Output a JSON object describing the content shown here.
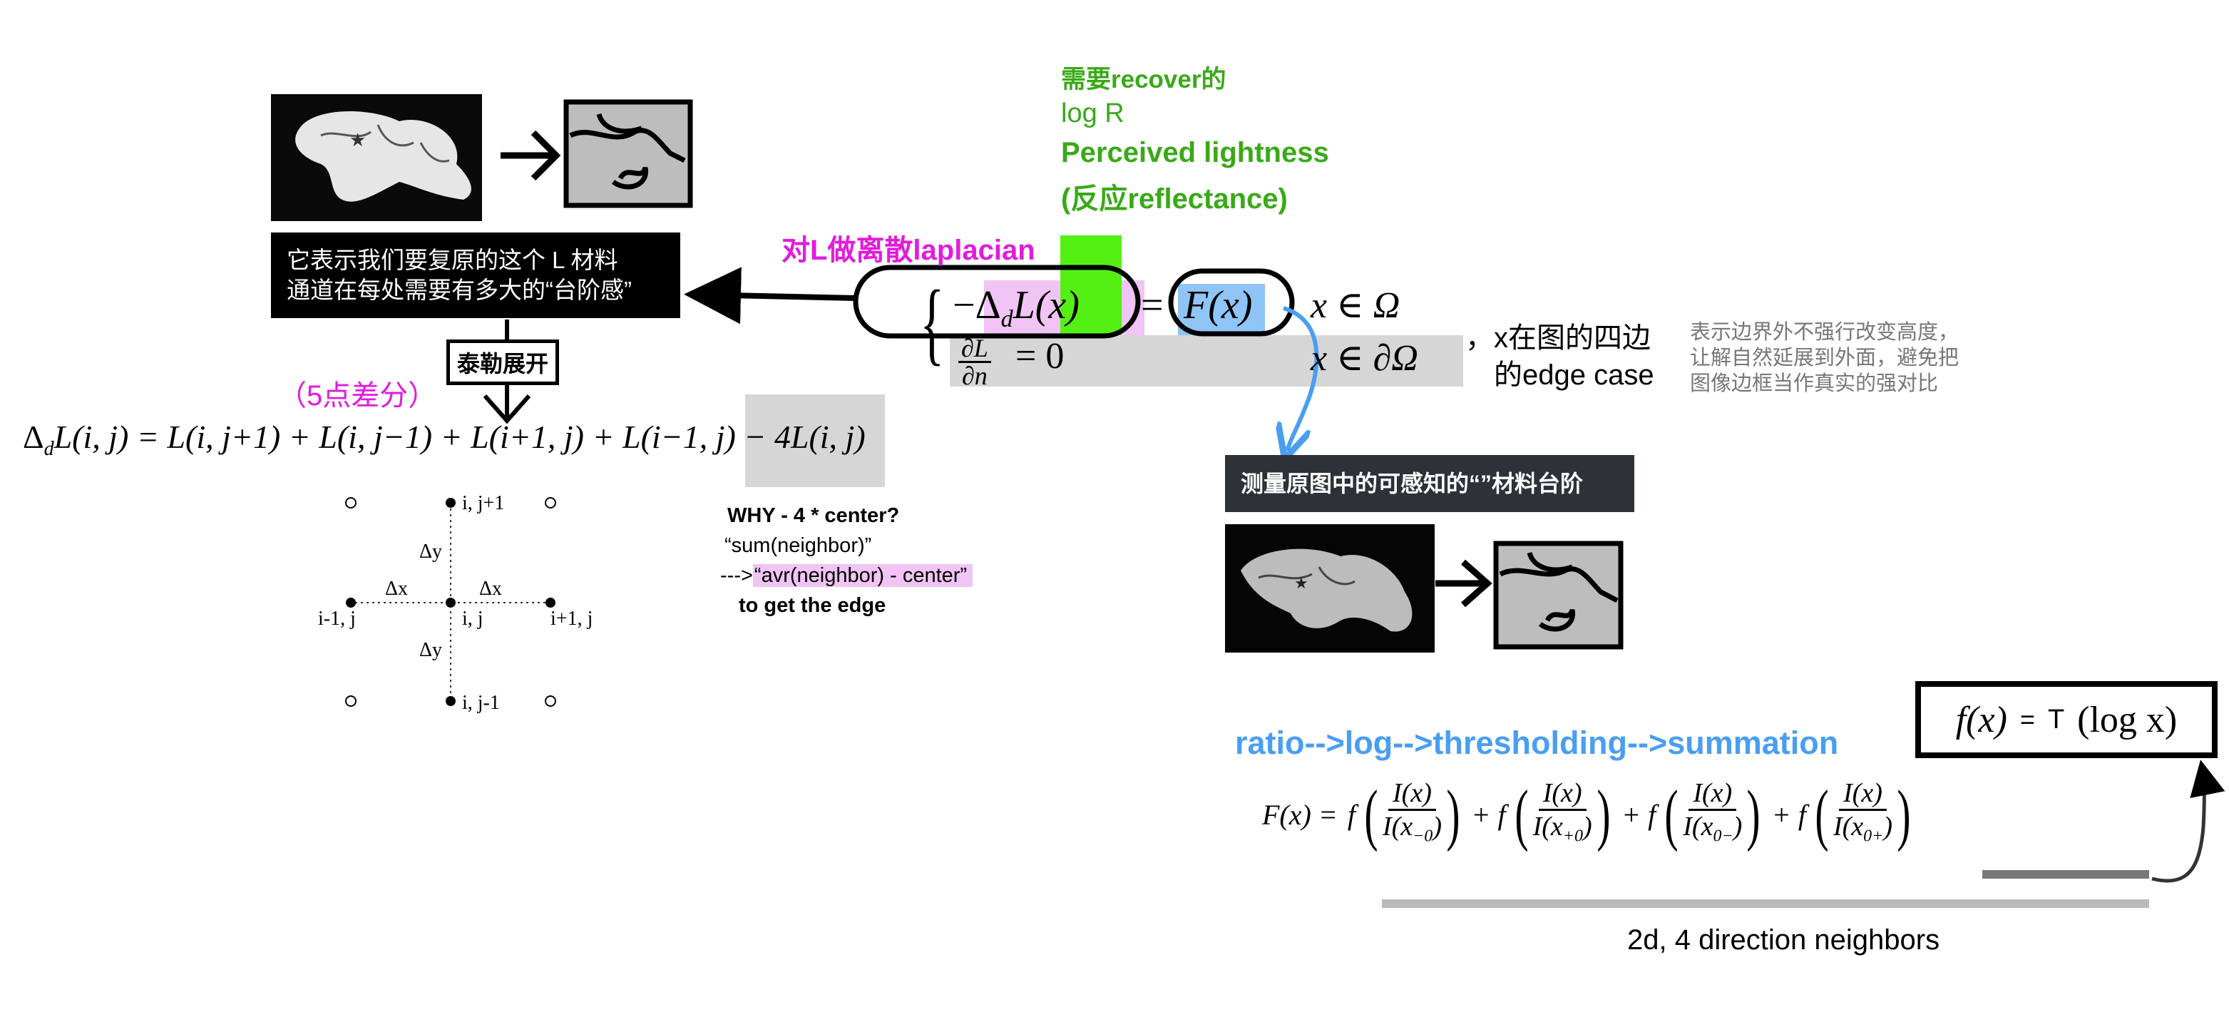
{
  "top_note": {
    "line1": "需要recover的",
    "line2": "log R",
    "line3": "Perceived lightness",
    "line4": "(反应reflectance)"
  },
  "laplacian_label": "对L做离散laplacian",
  "explain_box": {
    "line1": "它表示我们要复原的这个 L 材料",
    "line2": "通道在每处需要有多大的“台阶感”"
  },
  "taylor_label": "泰勒展开",
  "five_point_label": "（5点差分）",
  "laplacian_formula": {
    "lhs": "Δ",
    "lhs_sub": "d",
    "rest": "L(i, j) = L(i, j+1) + L(i, j−1) + L(i+1, j) + L(i−1, j)",
    "tail": "− 4L(i, j)"
  },
  "stencil": {
    "top": "i, j+1",
    "center": "i, j",
    "left": "i-1, j",
    "right": "i+1, j",
    "bottom": "i, j-1",
    "dx_left": "Δx",
    "dx_right": "Δx",
    "dy_top": "Δy",
    "dy_bottom": "Δy"
  },
  "why_note": {
    "line1": "WHY - 4 * center?",
    "line2": "“sum(neighbor)”",
    "line3_prefix": "--->",
    "line3_highlight": "“avr(neighbor) - center”",
    "line4": "to get the edge"
  },
  "pde": {
    "eq1_lhs": "−Δ",
    "eq1_sub": "d",
    "eq1_L": "L(x)",
    "eq1_eq": "=",
    "eq1_rhs": "F(x)",
    "eq1_domain": "x ∈ Ω",
    "eq2_num": "∂L",
    "eq2_den": "∂n",
    "eq2_rhs": "= 0",
    "eq2_domain": "x ∈ ∂Ω"
  },
  "edge_case": {
    "line1": "，x在图的四边",
    "line2": "的edge case"
  },
  "boundary_note": {
    "line1": "表示边界外不强行改变高度，",
    "line2": "让解自然延展到外面，避免把",
    "line3": "图像边框当作真实的强对比"
  },
  "measure_box": "测量原图中的可感知的“”材料台阶",
  "pipeline_label": "ratio-->log-->thresholding-->summation",
  "f_box": {
    "f": "f(x)",
    "eq": "=",
    "t": "T",
    "rest": "(log x)"
  },
  "F_formula": {
    "lhs": "F(x) =",
    "terms": [
      {
        "num": "I(x)",
        "den": "I(x",
        "den_sub": "−0",
        "den_end": ")"
      },
      {
        "num": "I(x)",
        "den": "I(x",
        "den_sub": "+0",
        "den_end": ")"
      },
      {
        "num": "I(x)",
        "den": "I(x",
        "den_sub": "0−",
        "den_end": ")"
      },
      {
        "num": "I(x)",
        "den": "I(x",
        "den_sub": "0+",
        "den_end": ")"
      }
    ]
  },
  "neighbors_label": "2d, 4 direction neighbors",
  "colors": {
    "green": "#3aa918",
    "magenta": "#e21bdc",
    "blue": "#4a9ef2",
    "pink_highlight": "#f0c4f4",
    "blue_highlight": "#8fc4f7",
    "bright_green": "#55f013",
    "gray_highlight": "#d6d6d6"
  }
}
